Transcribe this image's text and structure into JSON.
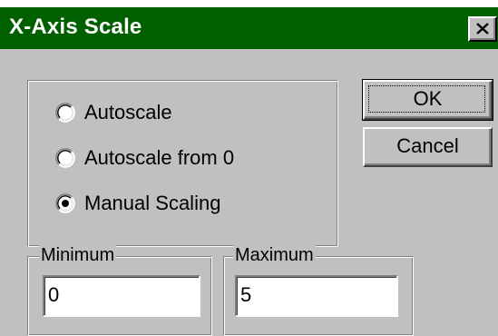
{
  "window": {
    "title": "X-Axis Scale",
    "title_bar_color": "#006000",
    "close_icon": "close-icon"
  },
  "scaling": {
    "options": [
      {
        "label": "Autoscale",
        "selected": false
      },
      {
        "label": "Autoscale from 0",
        "selected": false
      },
      {
        "label": "Manual Scaling",
        "selected": true
      }
    ]
  },
  "buttons": {
    "ok_label": "OK",
    "cancel_label": "Cancel"
  },
  "minimum": {
    "caption": "Minimum",
    "value": "0"
  },
  "maximum": {
    "caption": "Maximum",
    "value": "5"
  }
}
